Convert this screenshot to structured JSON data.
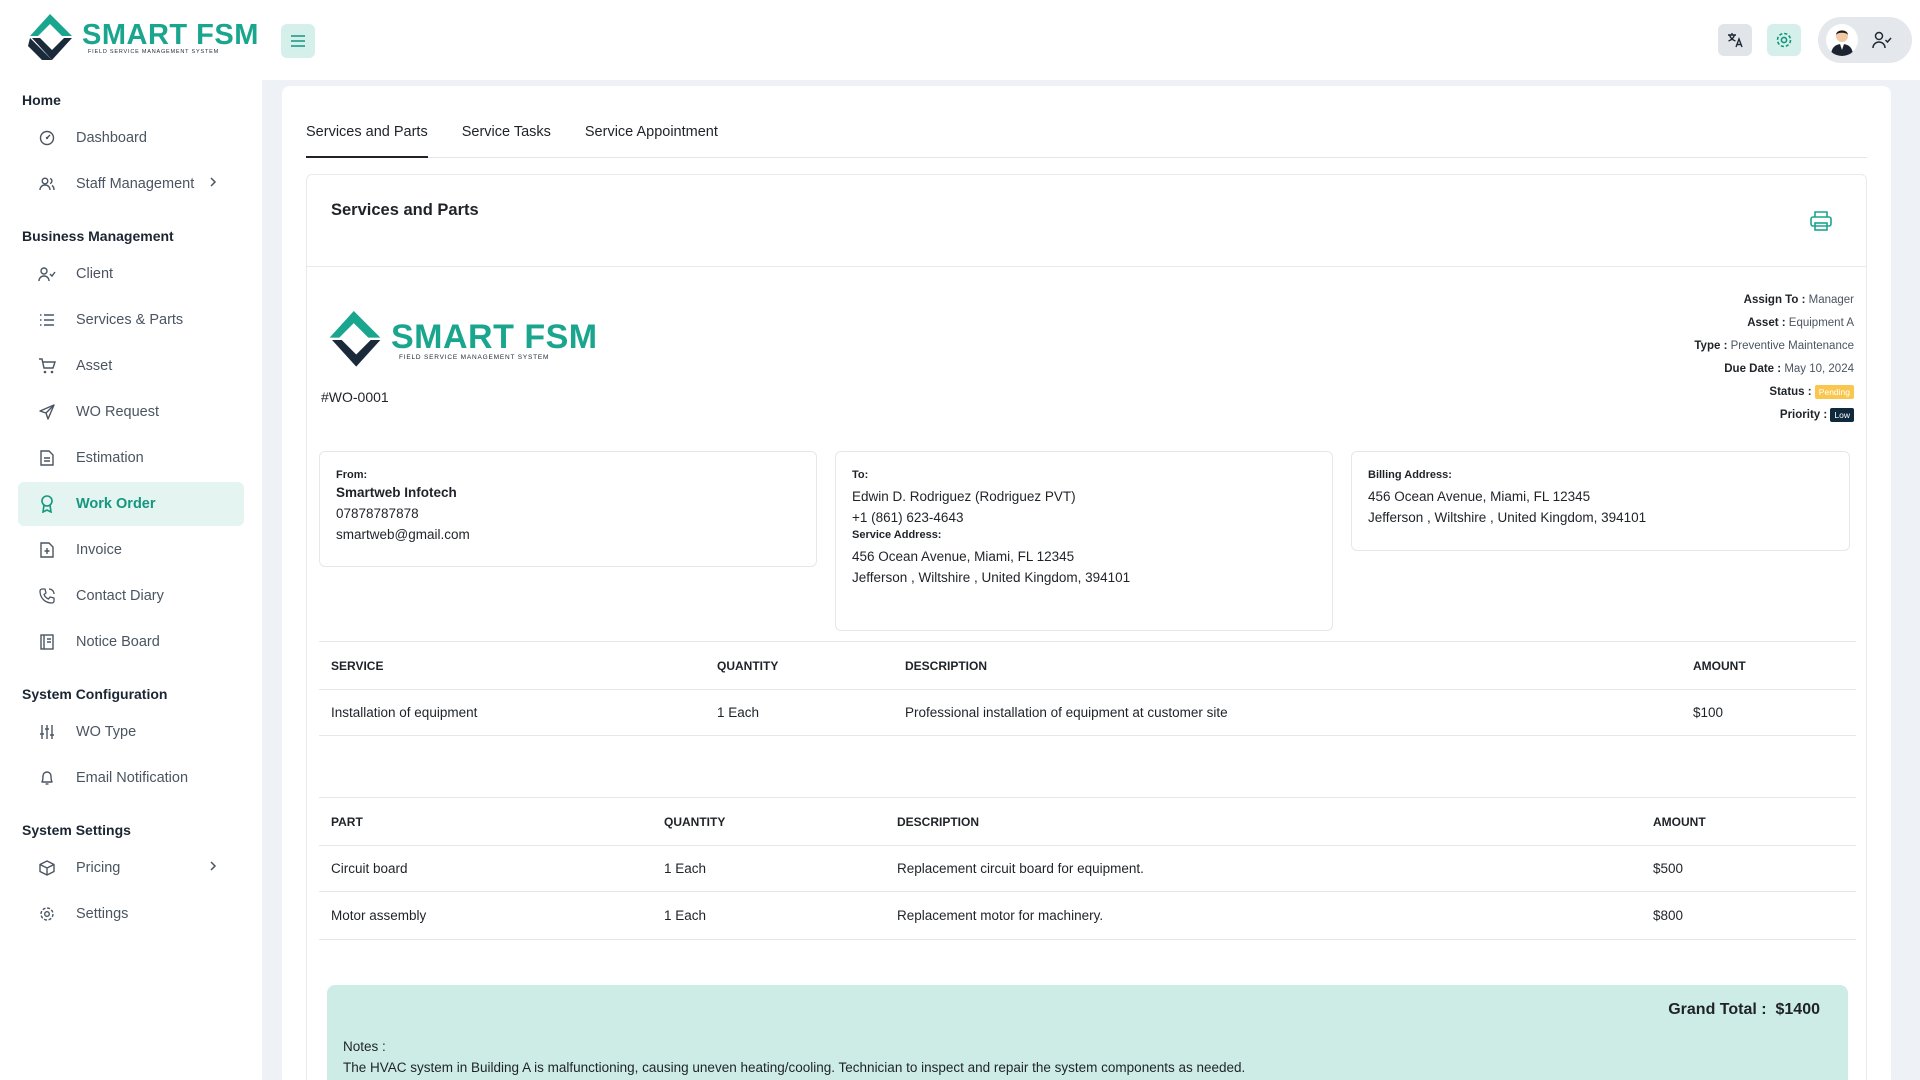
{
  "brand": {
    "title": "SMART FSM",
    "subtitle": "FIELD SERVICE MANAGEMENT SYSTEM",
    "primary_color": "#1aa58e",
    "dark_color": "#1b2a3a"
  },
  "sidebar": {
    "sections": [
      {
        "title": "Home",
        "items": [
          {
            "label": "Dashboard",
            "icon": "dashboard-icon"
          },
          {
            "label": "Staff Management",
            "icon": "users-icon",
            "expandable": true
          }
        ]
      },
      {
        "title": "Business Management",
        "items": [
          {
            "label": "Client",
            "icon": "user-check-icon"
          },
          {
            "label": "Services & Parts",
            "icon": "list-icon"
          },
          {
            "label": "Asset",
            "icon": "cart-icon"
          },
          {
            "label": "WO Request",
            "icon": "send-icon"
          },
          {
            "label": "Estimation",
            "icon": "document-icon"
          },
          {
            "label": "Work Order",
            "icon": "award-icon",
            "active": true
          },
          {
            "label": "Invoice",
            "icon": "invoice-icon"
          },
          {
            "label": "Contact Diary",
            "icon": "phone-icon"
          },
          {
            "label": "Notice Board",
            "icon": "notebook-icon"
          }
        ]
      },
      {
        "title": "System Configuration",
        "items": [
          {
            "label": "WO Type",
            "icon": "sliders-icon"
          },
          {
            "label": "Email Notification",
            "icon": "bell-icon"
          }
        ]
      },
      {
        "title": "System Settings",
        "items": [
          {
            "label": "Pricing",
            "icon": "box-icon",
            "expandable": true
          },
          {
            "label": "Settings",
            "icon": "gear-icon"
          }
        ]
      }
    ]
  },
  "tabs": [
    "Services and Parts",
    "Service Tasks",
    "Service Appointment"
  ],
  "panel_title": "Services and Parts",
  "work_order": {
    "number": "#WO-0001",
    "assign_to_label": "Assign To :",
    "assign_to": "Manager",
    "asset_label": "Asset :",
    "asset": "Equipment A",
    "type_label": "Type :",
    "type": "Preventive Maintenance",
    "due_label": "Due Date :",
    "due_date": "May 10, 2024",
    "status_label": "Status :",
    "status": "Pending",
    "priority_label": "Priority :",
    "priority": "Low"
  },
  "from": {
    "label": "From:",
    "name": "Smartweb Infotech",
    "phone": "07878787878",
    "email": "smartweb@gmail.com"
  },
  "to": {
    "label": "To:",
    "name": "Edwin D. Rodriguez (Rodriguez PVT)",
    "phone": "+1 (861) 623-4643",
    "service_label": "Service Address:",
    "line1": "456 Ocean Avenue, Miami, FL 12345",
    "line2": "Jefferson , Wiltshire , United Kingdom, 394101"
  },
  "billing": {
    "label": "Billing Address:",
    "line1": "456 Ocean Avenue, Miami, FL 12345",
    "line2": "Jefferson , Wiltshire , United Kingdom, 394101"
  },
  "services_table": {
    "headers": [
      "SERVICE",
      "QUANTITY",
      "DESCRIPTION",
      "AMOUNT"
    ],
    "rows": [
      [
        "Installation of equipment",
        "1 Each",
        "Professional installation of equipment at customer site",
        "$100"
      ]
    ]
  },
  "parts_table": {
    "headers": [
      "PART",
      "QUANTITY",
      "DESCRIPTION",
      "AMOUNT"
    ],
    "rows": [
      [
        "Circuit board",
        "1 Each",
        "Replacement circuit board for equipment.",
        "$500"
      ],
      [
        "Motor assembly",
        "1 Each",
        "Replacement motor for machinery.",
        "$800"
      ]
    ]
  },
  "totals": {
    "grand_label": "Grand Total :",
    "grand_value": "$1400"
  },
  "notes": {
    "label": "Notes :",
    "text": "The HVAC system in Building A is malfunctioning, causing uneven heating/cooling. Technician to inspect and repair the system components as needed."
  }
}
